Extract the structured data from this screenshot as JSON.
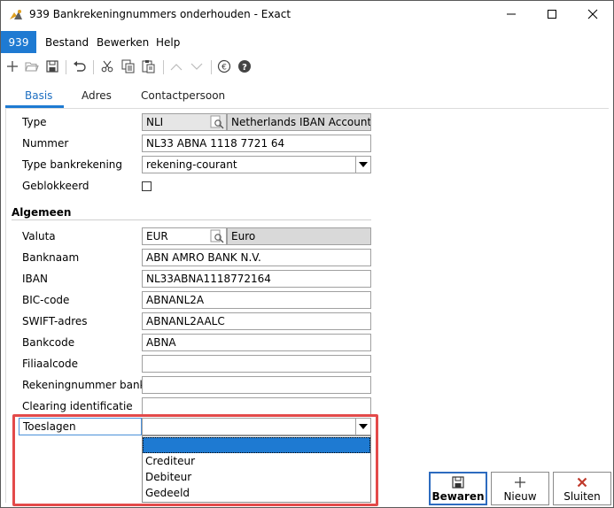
{
  "window": {
    "title": "939 Bankrekeningnummers onderhouden - Exact",
    "logo_icon": "exact-logo-icon",
    "minimize_icon": "minimize-icon",
    "maximize_icon": "maximize-icon",
    "close_icon": "close-icon"
  },
  "menu": {
    "number": "939",
    "items": [
      "Bestand",
      "Bewerken",
      "Help"
    ]
  },
  "toolbar": {
    "icons": [
      "new-icon",
      "open-folder-icon",
      "save-icon",
      "undo-icon",
      "cut-icon",
      "copy-icon",
      "paste-icon",
      "chevron-up-icon",
      "chevron-down-icon",
      "euro-icon",
      "help-icon"
    ]
  },
  "tabs": [
    "Basis",
    "Adres",
    "Contactpersoon"
  ],
  "form": {
    "type": {
      "label": "Type",
      "code": "NLI",
      "description": "Netherlands IBAN Account"
    },
    "nummer": {
      "label": "Nummer",
      "value": "NL33 ABNA 1118 7721 64"
    },
    "type_bankrekening": {
      "label": "Type bankrekening",
      "value": "rekening-courant"
    },
    "geblokkeerd": {
      "label": "Geblokkeerd",
      "checked": false
    },
    "section_algemeen": "Algemeen",
    "valuta": {
      "label": "Valuta",
      "code": "EUR",
      "description": "Euro"
    },
    "banknaam": {
      "label": "Banknaam",
      "value": "ABN AMRO BANK N.V."
    },
    "iban": {
      "label": "IBAN",
      "value": "NL33ABNA1118772164"
    },
    "bic": {
      "label": "BIC-code",
      "value": "ABNANL2A"
    },
    "swift": {
      "label": "SWIFT-adres",
      "value": "ABNANL2AALC"
    },
    "bankcode": {
      "label": "Bankcode",
      "value": "ABNA"
    },
    "filiaalcode": {
      "label": "Filiaalcode",
      "value": ""
    },
    "rekeningnummer_bank": {
      "label": "Rekeningnummer bank",
      "value": ""
    },
    "clearing": {
      "label": "Clearing identificatie",
      "value": ""
    },
    "toeslagen": {
      "label": "Toeslagen",
      "value": "",
      "options": [
        "",
        "Crediteur",
        "Debiteur",
        "Gedeeld"
      ]
    }
  },
  "buttons": {
    "save": {
      "label": "Bewaren",
      "icon": "save-icon"
    },
    "new": {
      "label": "Nieuw",
      "icon": "plus-icon"
    },
    "close": {
      "label": "Sluiten",
      "icon": "close-x-icon"
    }
  },
  "colors": {
    "accent": "#1e7ad2",
    "highlight": "#e34a4a",
    "close_red": "#c0392b"
  }
}
